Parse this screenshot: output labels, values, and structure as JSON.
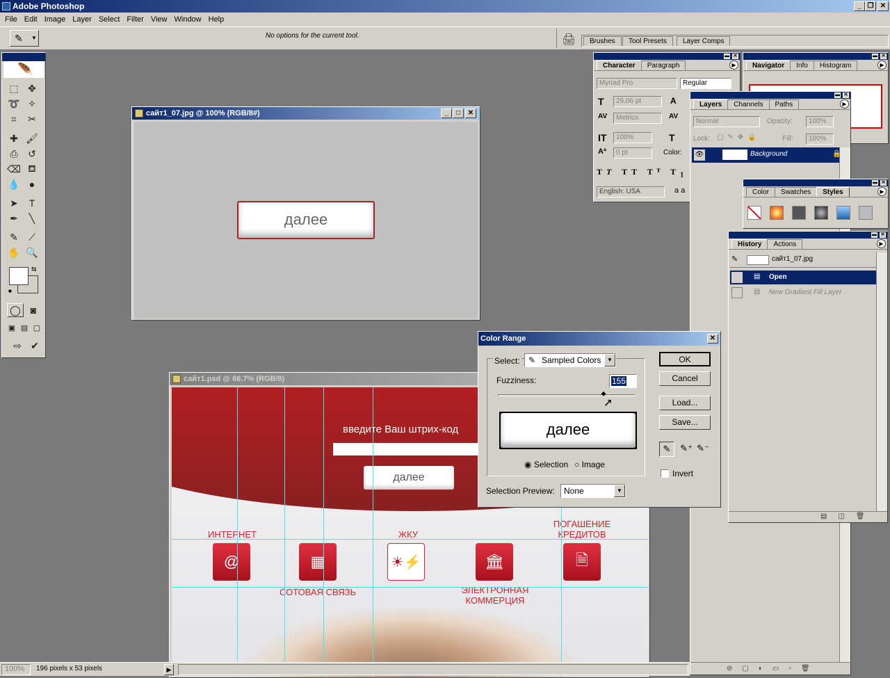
{
  "app": {
    "title": "Adobe Photoshop"
  },
  "menu": [
    "File",
    "Edit",
    "Image",
    "Layer",
    "Select",
    "Filter",
    "View",
    "Window",
    "Help"
  ],
  "options": {
    "message": "No options for the current tool."
  },
  "well_tabs": [
    "Brushes",
    "Tool Presets",
    "Layer Comps"
  ],
  "character": {
    "tabs": [
      "Character",
      "Paragraph"
    ],
    "font": "Myriad Pro",
    "style": "Regular",
    "size": "29.06 pt",
    "kerning": "Metrics",
    "scale": "100%",
    "baseline": "0 pt",
    "color_label": "Color:",
    "language": "English: USA",
    "aa": "a a"
  },
  "navigator": {
    "tabs": [
      "Navigator",
      "Info",
      "Histogram"
    ]
  },
  "layers": {
    "tabs": [
      "Layers",
      "Channels",
      "Paths"
    ],
    "blend": "Normal",
    "opacity_label": "Opacity:",
    "opacity": "100%",
    "lock_label": "Lock:",
    "fill_label": "Fill:",
    "fill": "100%",
    "layer_name": "Background"
  },
  "styles": {
    "tabs": [
      "Color",
      "Swatches",
      "Styles"
    ]
  },
  "history": {
    "tabs": [
      "History",
      "Actions"
    ],
    "snapshot": "сайт1_07.jpg",
    "items": [
      "Open",
      "New Gradient Fill Layer"
    ]
  },
  "doc1": {
    "title": "сайт1_07.jpg @ 100% (RGB/8#)",
    "button_text": "далее"
  },
  "doc2": {
    "title": "сайт1.psd @ 66.7% (RGB/8)",
    "prompt": "введите Ваш штрих-код",
    "button_text": "далее",
    "labels": {
      "internet": "ИНТЕРНЕТ",
      "zhku": "ЖКУ",
      "credits1": "ПОГАШЕНИЕ",
      "credits2": "КРЕДИТОВ",
      "mobile": "СОТОВАЯ СВЯЗЬ",
      "ecom1": "ЭЛЕКТРОННАЯ",
      "ecom2": "КОММЕРЦИЯ"
    }
  },
  "dialog": {
    "title": "Color Range",
    "select_label": "Select:",
    "select_value": "Sampled Colors",
    "fuzziness_label": "Fuzziness:",
    "fuzziness": "155",
    "fuzziness_fraction": 0.77,
    "preview_text": "далее",
    "radio_selection": "Selection",
    "radio_image": "Image",
    "preview_label": "Selection Preview:",
    "preview_value": "None",
    "ok": "OK",
    "cancel": "Cancel",
    "load": "Load...",
    "save": "Save...",
    "invert": "Invert"
  },
  "status": {
    "zoom": "100%",
    "info": "196 pixels x 53 pixels"
  }
}
